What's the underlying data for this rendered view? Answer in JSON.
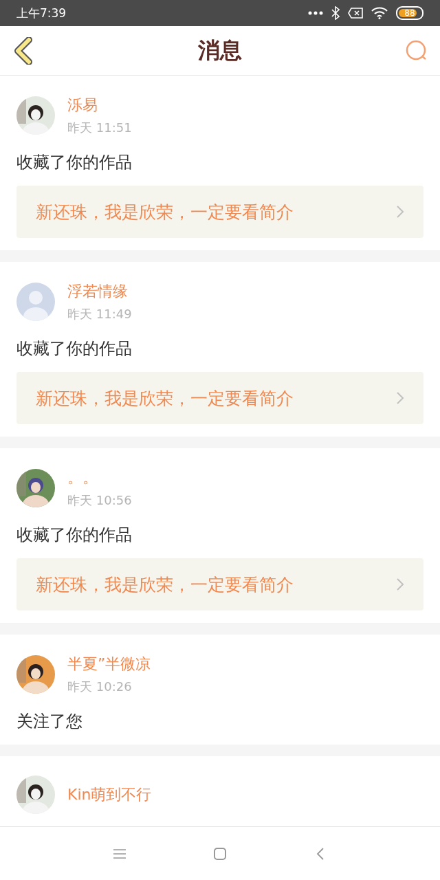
{
  "status_bar": {
    "time": "上午7:39",
    "battery": "88"
  },
  "header": {
    "title": "消息"
  },
  "messages": [
    {
      "name": "泺易",
      "time": "昨天 11:51",
      "action": "收藏了你的作品",
      "work": "新还珠，我是欣荣，一定要看简介"
    },
    {
      "avatar": {
        "kind": "default"
      },
      "name": "浮若情缘",
      "time": "昨天 11:49",
      "action": "收藏了你的作品",
      "work": "新还珠，我是欣荣，一定要看简介"
    },
    {
      "name": "。。",
      "time": "昨天 10:56",
      "action": "收藏了你的作品",
      "work": "新还珠，我是欣荣，一定要看简介"
    },
    {
      "name": "半夏”半微凉",
      "time": "昨天 10:26",
      "action": "关注了您"
    },
    {
      "name": "Kin萌到不行"
    }
  ]
}
